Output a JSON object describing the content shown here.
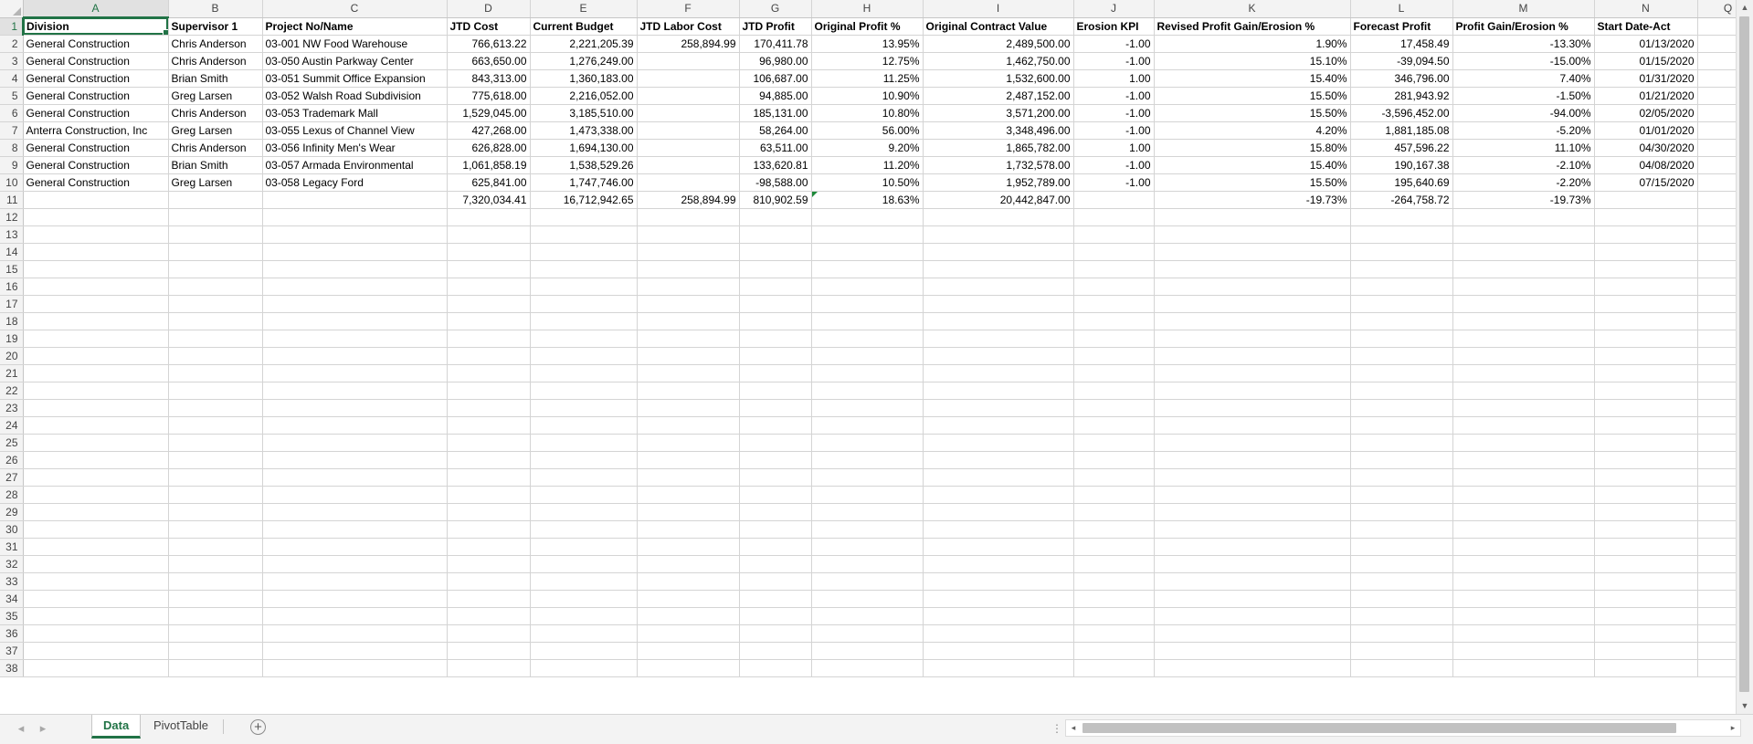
{
  "columns": [
    "A",
    "B",
    "C",
    "D",
    "E",
    "F",
    "G",
    "H",
    "I",
    "J",
    "K",
    "L",
    "M",
    "N",
    "Q"
  ],
  "selected_column": "A",
  "selected_row": 1,
  "rows": [
    {
      "n": "1",
      "cells": [
        "Division",
        "Supervisor 1",
        "Project No/Name",
        "JTD Cost",
        "Current Budget",
        "JTD Labor Cost",
        "JTD Profit",
        "Original Profit %",
        "Original Contract Value",
        "Erosion KPI",
        "Revised Profit Gain/Erosion %",
        "Forecast Profit",
        "Profit Gain/Erosion %",
        "Start Date-Act",
        ""
      ]
    },
    {
      "n": "2",
      "cells": [
        "General Construction",
        "Chris Anderson",
        "03-001 NW Food Warehouse",
        "766,613.22",
        "2,221,205.39",
        "258,894.99",
        "170,411.78",
        "13.95%",
        "2,489,500.00",
        "-1.00",
        "1.90%",
        "17,458.49",
        "-13.30%",
        "01/13/2020",
        ""
      ]
    },
    {
      "n": "3",
      "cells": [
        "General Construction",
        "Chris Anderson",
        "03-050 Austin Parkway Center",
        "663,650.00",
        "1,276,249.00",
        "",
        "96,980.00",
        "12.75%",
        "1,462,750.00",
        "-1.00",
        "15.10%",
        "-39,094.50",
        "-15.00%",
        "01/15/2020",
        ""
      ]
    },
    {
      "n": "4",
      "cells": [
        "General Construction",
        "Brian Smith",
        "03-051 Summit Office Expansion",
        "843,313.00",
        "1,360,183.00",
        "",
        "106,687.00",
        "11.25%",
        "1,532,600.00",
        "1.00",
        "15.40%",
        "346,796.00",
        "7.40%",
        "01/31/2020",
        ""
      ]
    },
    {
      "n": "5",
      "cells": [
        "General Construction",
        "Greg Larsen",
        "03-052 Walsh Road Subdivision",
        "775,618.00",
        "2,216,052.00",
        "",
        "94,885.00",
        "10.90%",
        "2,487,152.00",
        "-1.00",
        "15.50%",
        "281,943.92",
        "-1.50%",
        "01/21/2020",
        ""
      ]
    },
    {
      "n": "6",
      "cells": [
        "General Construction",
        "Chris Anderson",
        "03-053 Trademark Mall",
        "1,529,045.00",
        "3,185,510.00",
        "",
        "185,131.00",
        "10.80%",
        "3,571,200.00",
        "-1.00",
        "15.50%",
        "-3,596,452.00",
        "-94.00%",
        "02/05/2020",
        ""
      ]
    },
    {
      "n": "7",
      "cells": [
        "Anterra Construction, Inc",
        "Greg Larsen",
        "03-055 Lexus of Channel View",
        "427,268.00",
        "1,473,338.00",
        "",
        "58,264.00",
        "56.00%",
        "3,348,496.00",
        "-1.00",
        "4.20%",
        "1,881,185.08",
        "-5.20%",
        "01/01/2020",
        ""
      ]
    },
    {
      "n": "8",
      "cells": [
        "General Construction",
        "Chris Anderson",
        "03-056 Infinity Men's Wear",
        "626,828.00",
        "1,694,130.00",
        "",
        "63,511.00",
        "9.20%",
        "1,865,782.00",
        "1.00",
        "15.80%",
        "457,596.22",
        "11.10%",
        "04/30/2020",
        ""
      ]
    },
    {
      "n": "9",
      "cells": [
        "General Construction",
        "Brian Smith",
        "03-057 Armada Environmental",
        "1,061,858.19",
        "1,538,529.26",
        "",
        "133,620.81",
        "11.20%",
        "1,732,578.00",
        "-1.00",
        "15.40%",
        "190,167.38",
        "-2.10%",
        "04/08/2020",
        ""
      ]
    },
    {
      "n": "10",
      "cells": [
        "General Construction",
        "Greg Larsen",
        "03-058 Legacy Ford",
        "625,841.00",
        "1,747,746.00",
        "",
        "-98,588.00",
        "10.50%",
        "1,952,789.00",
        "-1.00",
        "15.50%",
        "195,640.69",
        "-2.20%",
        "07/15/2020",
        ""
      ]
    },
    {
      "n": "11",
      "cells": [
        "",
        "",
        "",
        "7,320,034.41",
        "16,712,942.65",
        "258,894.99",
        "810,902.59",
        "18.63%",
        "20,442,847.00",
        "",
        "-19.73%",
        "-264,758.72",
        "-19.73%",
        "",
        ""
      ]
    },
    {
      "n": "12",
      "cells": []
    },
    {
      "n": "13",
      "cells": []
    },
    {
      "n": "14",
      "cells": []
    },
    {
      "n": "15",
      "cells": []
    },
    {
      "n": "16",
      "cells": []
    },
    {
      "n": "17",
      "cells": []
    },
    {
      "n": "18",
      "cells": []
    },
    {
      "n": "19",
      "cells": []
    },
    {
      "n": "20",
      "cells": []
    },
    {
      "n": "21",
      "cells": []
    },
    {
      "n": "22",
      "cells": []
    },
    {
      "n": "23",
      "cells": []
    },
    {
      "n": "24",
      "cells": []
    },
    {
      "n": "25",
      "cells": []
    },
    {
      "n": "26",
      "cells": []
    },
    {
      "n": "27",
      "cells": []
    },
    {
      "n": "28",
      "cells": []
    },
    {
      "n": "29",
      "cells": []
    },
    {
      "n": "30",
      "cells": []
    },
    {
      "n": "31",
      "cells": []
    },
    {
      "n": "32",
      "cells": []
    },
    {
      "n": "33",
      "cells": []
    },
    {
      "n": "34",
      "cells": []
    },
    {
      "n": "35",
      "cells": []
    },
    {
      "n": "36",
      "cells": []
    },
    {
      "n": "37",
      "cells": []
    },
    {
      "n": "38",
      "cells": []
    }
  ],
  "sheet_tabs": [
    {
      "label": "Data",
      "active": true
    },
    {
      "label": "PivotTable",
      "active": false
    }
  ],
  "icons": {
    "prev_sheet": "◂",
    "next_sheet": "▸",
    "add_sheet": "+",
    "splitter": "⋮",
    "scroll_up": "▲",
    "scroll_down": "▼",
    "scroll_left": "◂",
    "scroll_right": "▸"
  },
  "colors": {
    "accent": "#217346",
    "grid": "#d4d4d4",
    "header_bg": "#f3f3f3"
  }
}
